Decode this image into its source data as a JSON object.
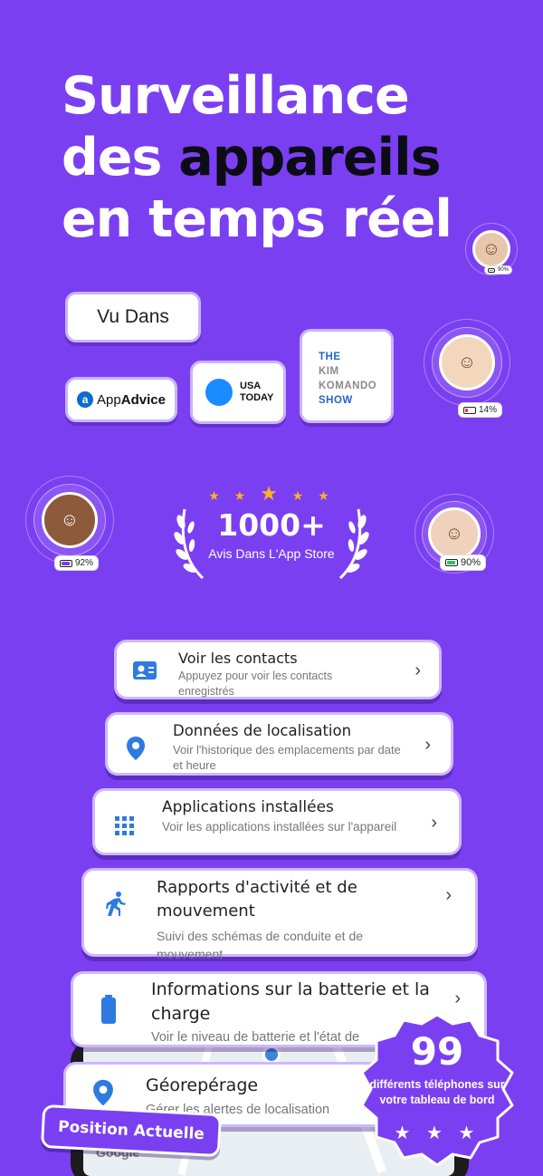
{
  "headline": {
    "line1": "Surveillance",
    "line2a": "des ",
    "line2b": "appareils",
    "line3": "en temps réel"
  },
  "press": {
    "vu_dans": "Vu Dans",
    "appadvice_a": "App",
    "appadvice_b": "Advice",
    "usa_today_1": "USA",
    "usa_today_2": "TODAY",
    "kim_1": "THE",
    "kim_2": "KIM",
    "kim_3": "KOMANDO",
    "kim_4": "SHOW"
  },
  "avatars": {
    "boy_right": {
      "battery": "14%",
      "battery_color": "#e23b3b"
    },
    "boy_left": {
      "battery": "92%",
      "battery_color": "#7b3ff2"
    },
    "grandma": {
      "battery": "90%",
      "battery_color": "#22c55e"
    },
    "man_top": {
      "battery": "90%",
      "battery_color": "#22c55e"
    }
  },
  "award": {
    "count": "1000+",
    "subtitle": "Avis Dans L'App Store"
  },
  "features": [
    {
      "title": "Voir les contacts",
      "subtitle": "Appuyez pour voir les contacts enregistrés",
      "icon": "contacts-icon"
    },
    {
      "title": "Données de localisation",
      "subtitle": "Voir l'historique des emplacements par date et heure",
      "icon": "location-pin-icon"
    },
    {
      "title": "Applications installées",
      "subtitle": "Voir les applications installées sur l'appareil",
      "icon": "apps-grid-icon"
    },
    {
      "title": "Rapports d'activité et de mouvement",
      "subtitle": "Suivi des schémas de conduite et de mouvement",
      "icon": "running-person-icon"
    },
    {
      "title": "Informations sur la batterie et la charge",
      "subtitle": "Voir le niveau de batterie et l'état de",
      "icon": "battery-icon"
    },
    {
      "title": "Géorepérage",
      "subtitle": "Gérer les alertes de localisation",
      "icon": "geofence-pin-icon"
    }
  ],
  "position_pill": "Position Actuelle",
  "seal": {
    "number": "99",
    "text": "différents téléphones sur votre tableau de bord"
  },
  "map": {
    "logo": "Google"
  },
  "colors": {
    "background": "#7b3ff2",
    "card_border": "#cdb8ff",
    "icon_blue": "#2d7be0"
  }
}
